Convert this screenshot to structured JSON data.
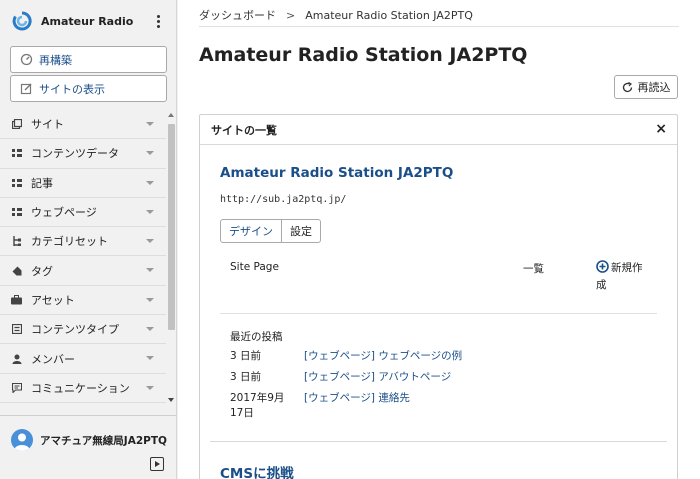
{
  "sidebar": {
    "title": "Amateur Radio St...",
    "rebuild_label": "再構築",
    "view_site_label": "サイトの表示",
    "items": [
      {
        "label": "サイト"
      },
      {
        "label": "コンテンツデータ"
      },
      {
        "label": "記事"
      },
      {
        "label": "ウェブページ"
      },
      {
        "label": "カテゴリセット"
      },
      {
        "label": "タグ"
      },
      {
        "label": "アセット"
      },
      {
        "label": "コンテンツタイプ"
      },
      {
        "label": "メンバー"
      },
      {
        "label": "コミュニケーション"
      }
    ],
    "user_name": "アマチュア無線局JA2PTQ"
  },
  "main": {
    "breadcrumb": {
      "item1": "ダッシュボード",
      "separator": ">",
      "item2": "Amateur Radio Station JA2PTQ"
    },
    "title": "Amateur Radio Station JA2PTQ",
    "reload_label": "再読込",
    "panel": {
      "title": "サイトの一覧",
      "close": "×",
      "site": {
        "name": "Amateur Radio Station JA2PTQ",
        "url": "http://sub.ja2ptq.jp/",
        "design_label": "デザイン",
        "settings_label": "設定",
        "page_label": "Site Page",
        "list_label": "一覧",
        "new_label": "新規作成",
        "recent_title": "最近の投稿",
        "recent": [
          {
            "date": "3 日前",
            "link": "[ウェブページ] ウェブページの例"
          },
          {
            "date": "3 日前",
            "link": "[ウェブページ] アバウトページ"
          },
          {
            "date": "2017年9月17日",
            "link": "[ウェブページ] 連絡先"
          }
        ]
      },
      "site2_name": "CMSに挑戦"
    }
  },
  "colors": {
    "accent": "#1b4f8a",
    "sidebar_bg": "#f1f1f1"
  }
}
